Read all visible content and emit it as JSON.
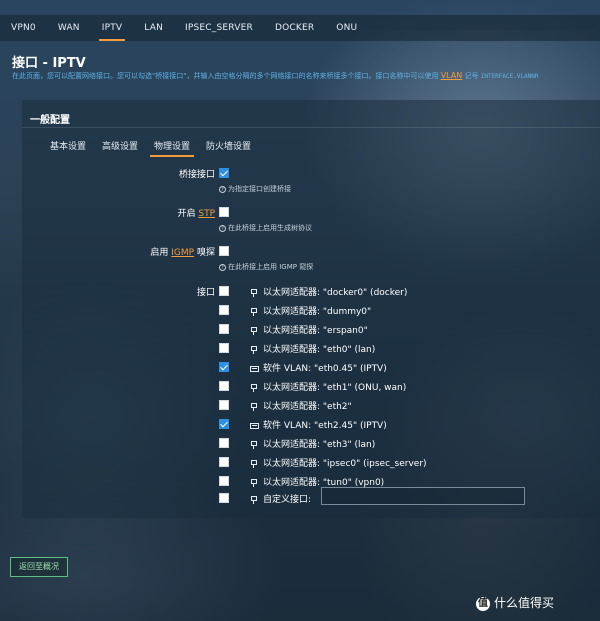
{
  "top_tabs": [
    "VPN0",
    "WAN",
    "IPTV",
    "LAN",
    "IPSEC_SERVER",
    "DOCKER",
    "ONU"
  ],
  "active_tab": "IPTV",
  "page": {
    "title": "接口 - IPTV",
    "description_pre": "在此页面，您可以配置网络接口。您可以勾选\"桥接接口\"，并输入由空格分隔的多个网络接口的名称来桥接多个接口。接口名称中可以使用",
    "description_vlan": "VLAN",
    "description_post": "记号",
    "description_mono": "INTERFACE.VLANNR"
  },
  "section": {
    "title": "一般配置"
  },
  "sub_tabs": [
    "基本设置",
    "高级设置",
    "物理设置",
    "防火墙设置"
  ],
  "active_sub_tab": "物理设置",
  "bridge": {
    "label": "桥接接口",
    "checked": true,
    "hint": "为指定接口创建桥接"
  },
  "stp": {
    "label_pre": "开启",
    "label_link": "STP",
    "checked": false,
    "hint": "在此桥接上启用生成树协议"
  },
  "igmp": {
    "label_pre": "启用",
    "label_link": "IGMP",
    "label_post": "嗅探",
    "checked": false,
    "hint": "在此桥接上启用 IGMP 窥探"
  },
  "interfaces_label": "接口",
  "interfaces": [
    {
      "icon": "ethernet-icon",
      "text": "以太网适配器: \"docker0\" (docker)",
      "checked": false
    },
    {
      "icon": "ethernet-icon",
      "text": "以太网适配器: \"dummy0\"",
      "checked": false
    },
    {
      "icon": "ethernet-icon",
      "text": "以太网适配器: \"erspan0\"",
      "checked": false
    },
    {
      "icon": "ethernet-icon",
      "text": "以太网适配器: \"eth0\" (lan)",
      "checked": false
    },
    {
      "icon": "vlan-icon",
      "text": "软件 VLAN: \"eth0.45\" (IPTV)",
      "checked": true
    },
    {
      "icon": "ethernet-icon",
      "text": "以太网适配器: \"eth1\" (ONU, wan)",
      "checked": false
    },
    {
      "icon": "ethernet-icon",
      "text": "以太网适配器: \"eth2\"",
      "checked": false
    },
    {
      "icon": "vlan-icon",
      "text": "软件 VLAN: \"eth2.45\" (IPTV)",
      "checked": true
    },
    {
      "icon": "ethernet-icon",
      "text": "以太网适配器: \"eth3\" (lan)",
      "checked": false
    },
    {
      "icon": "ethernet-icon",
      "text": "以太网适配器: \"ipsec0\" (ipsec_server)",
      "checked": false
    },
    {
      "icon": "ethernet-icon",
      "text": "以太网适配器: \"tun0\" (vpn0)",
      "checked": false
    }
  ],
  "custom_iface": {
    "label": "自定义接口:",
    "value": "",
    "checked": false
  },
  "back_button": "返回至概况",
  "watermark": {
    "logo": "值",
    "text": "什么值得买"
  }
}
